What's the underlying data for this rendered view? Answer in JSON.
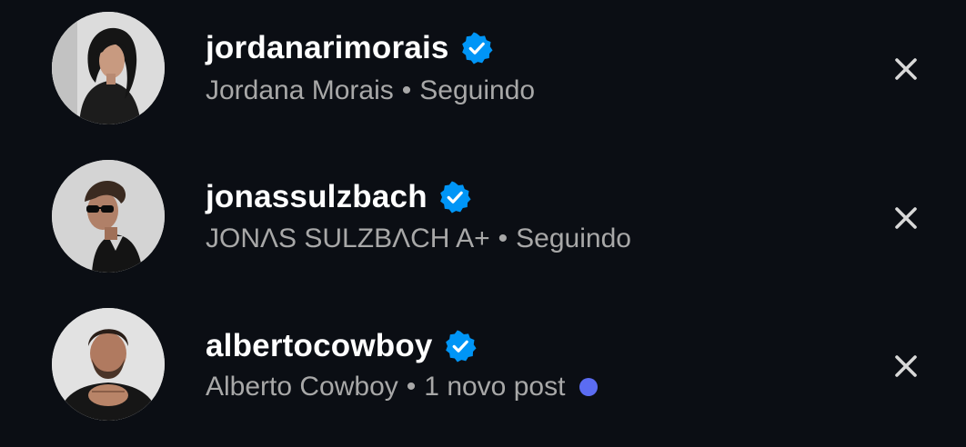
{
  "suggestions": [
    {
      "username": "jordanarimorais",
      "full_name": "Jordana Morais",
      "separator": "•",
      "status": "Seguindo",
      "verified": true,
      "new_post_indicator": false
    },
    {
      "username": "jonassulzbach",
      "full_name": "JONΛS SULZBΛCH A+",
      "separator": "•",
      "status": "Seguindo",
      "verified": true,
      "new_post_indicator": false
    },
    {
      "username": "albertocowboy",
      "full_name": "Alberto Cowboy",
      "separator": "•",
      "status": "1 novo post",
      "verified": true,
      "new_post_indicator": true
    }
  ],
  "colors": {
    "background": "#0b0e14",
    "username": "#ffffff",
    "subtitle": "#a8a8a8",
    "verified_badge": "#0095f6",
    "new_post_dot": "#5b6cf2",
    "close_icon": "#d8d8d8"
  },
  "icons": {
    "verified": "verified-badge-icon",
    "dismiss": "close-icon"
  }
}
